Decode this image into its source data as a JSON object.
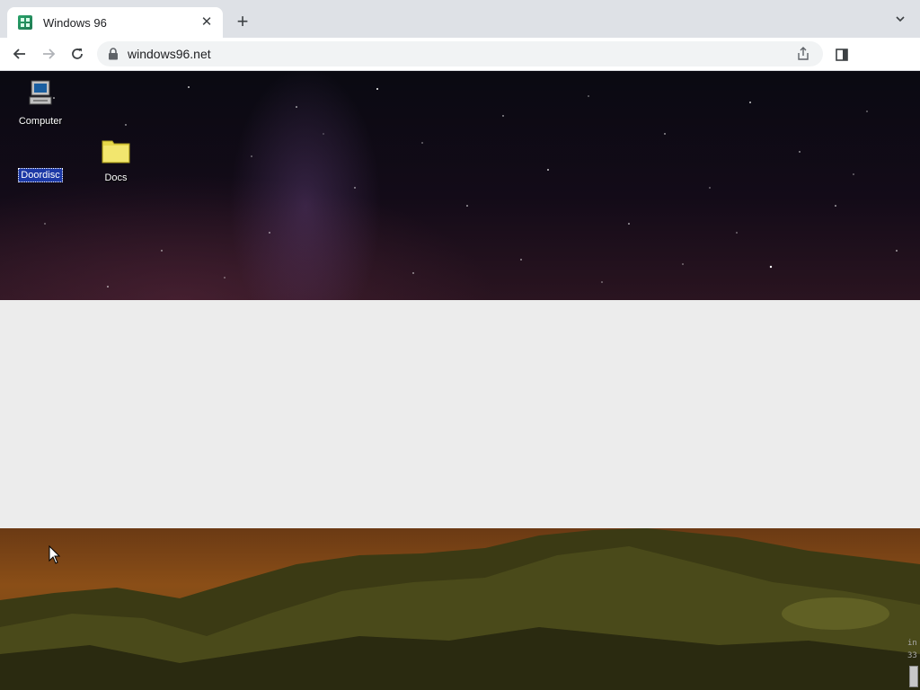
{
  "browser": {
    "tab": {
      "title": "Windows 96",
      "favicon": "windows96-icon"
    },
    "new_tab_label": "+",
    "url": "windows96.net"
  },
  "desktop": {
    "icons": [
      {
        "label": "Computer",
        "icon": "computer-icon",
        "selected": false
      },
      {
        "label": "Doordisc",
        "icon": "blank-icon",
        "selected": true
      },
      {
        "label": "Docs",
        "icon": "folder-icon",
        "selected": false
      }
    ],
    "corner_text": "in\n33"
  },
  "colors": {
    "selection": "#1c39a6",
    "folder": "#f2e66e",
    "blank_band": "#ececec"
  }
}
